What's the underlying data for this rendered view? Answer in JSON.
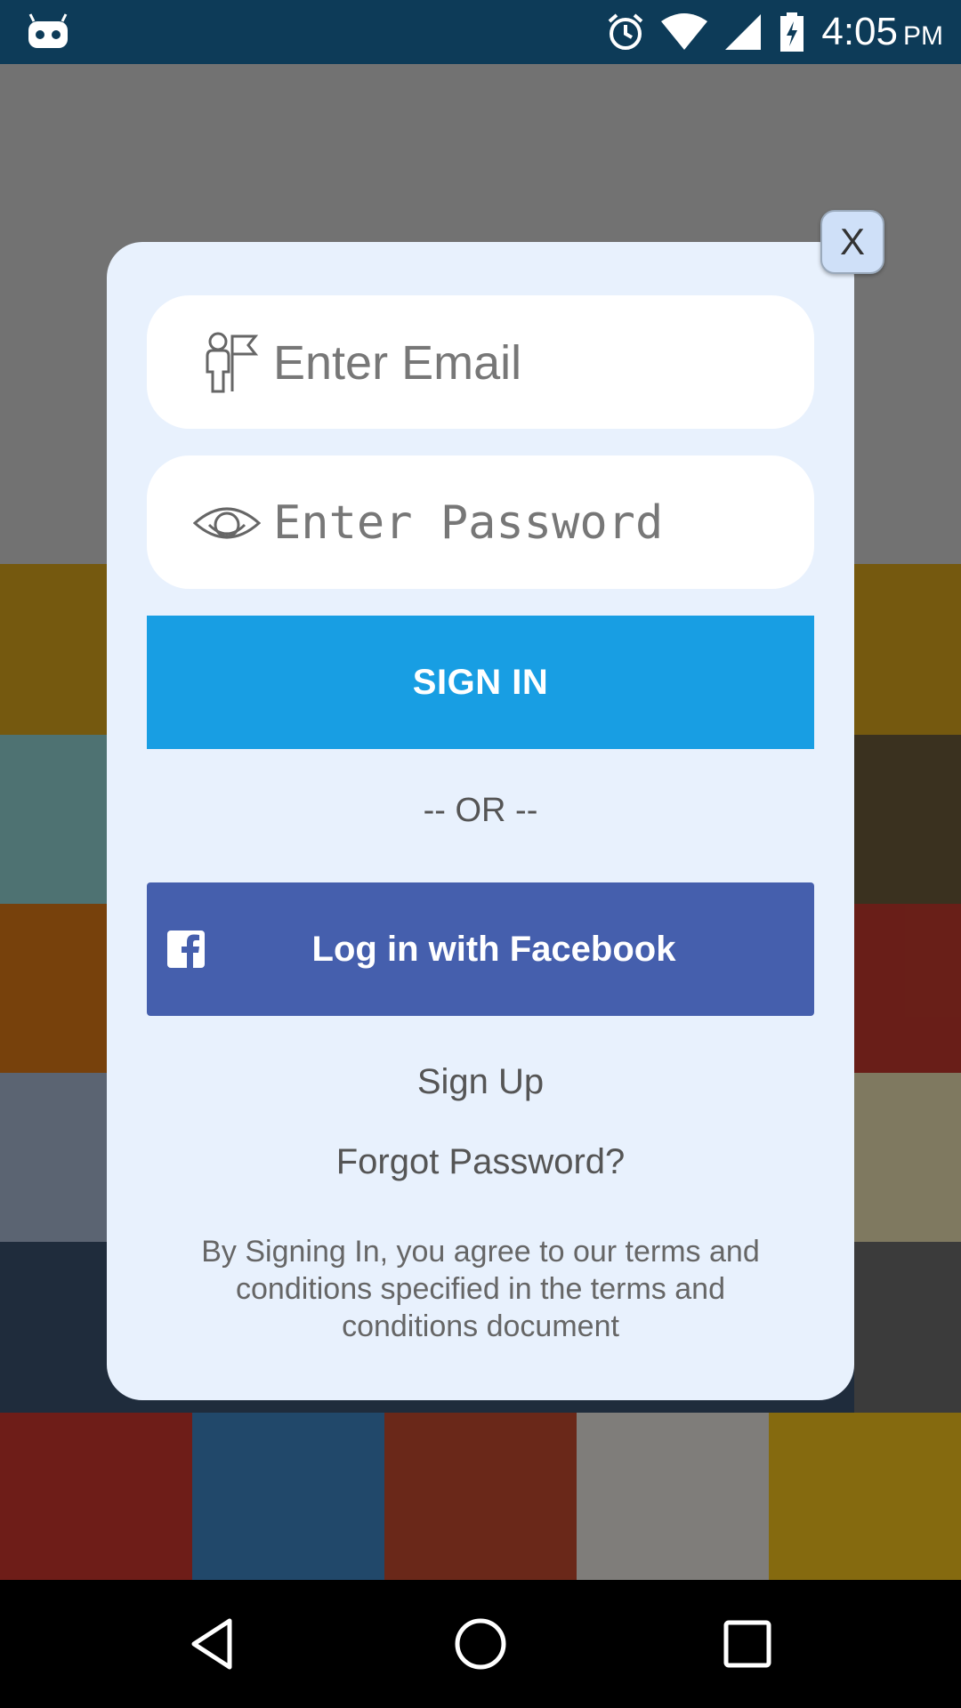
{
  "status_bar": {
    "time": "4:05",
    "ampm": "PM"
  },
  "login": {
    "email_placeholder": "Enter Email",
    "password_placeholder": "Enter Password",
    "sign_in_label": "SIGN IN",
    "or_text": "-- OR --",
    "facebook_label": "Log in with Facebook",
    "sign_up_label": "Sign Up",
    "forgot_label": "Forgot Password?",
    "terms_text": "By Signing In, you agree to our terms and conditions specified in the terms and conditions document",
    "close_label": "X"
  },
  "colors": {
    "status_bar": "#0d3b58",
    "modal_bg": "#e8f1fd",
    "sign_in": "#189ee3",
    "facebook": "#455fad"
  }
}
